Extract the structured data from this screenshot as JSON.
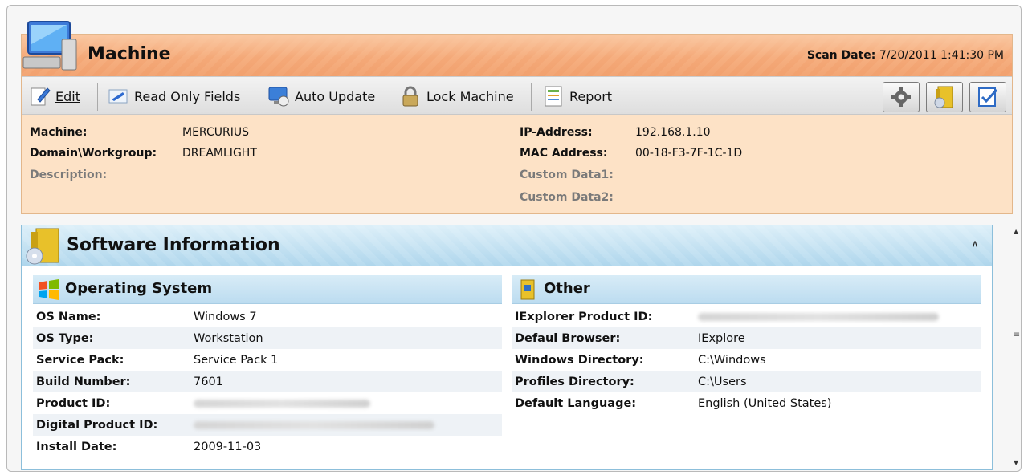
{
  "machine_panel": {
    "title": "Machine",
    "scan_date_label": "Scan Date:",
    "scan_date_value": "7/20/2011 1:41:30 PM",
    "toolbar": {
      "edit": "Edit",
      "read_only_fields": "Read Only Fields",
      "auto_update": "Auto Update",
      "lock_machine": "Lock Machine",
      "report": "Report"
    },
    "fields": {
      "machine_label": "Machine:",
      "machine_value": "MERCURIUS",
      "domain_label": "Domain\\Workgroup:",
      "domain_value": "DREAMLIGHT",
      "description_label": "Description:",
      "ip_label": "IP-Address:",
      "ip_value": "192.168.1.10",
      "mac_label": "MAC Address:",
      "mac_value": "00-18-F3-7F-1C-1D",
      "custom1_label": "Custom Data1:",
      "custom2_label": "Custom Data2:"
    }
  },
  "software_panel": {
    "title": "Software Information",
    "os": {
      "title": "Operating System",
      "rows": [
        {
          "k": "OS Name:",
          "v": "Windows 7"
        },
        {
          "k": "OS Type:",
          "v": "Workstation"
        },
        {
          "k": "Service Pack:",
          "v": "Service Pack 1"
        },
        {
          "k": "Build Number:",
          "v": "7601"
        },
        {
          "k": "Product ID:",
          "v": ""
        },
        {
          "k": "Digital Product ID:",
          "v": ""
        },
        {
          "k": "Install Date:",
          "v": "2009-11-03"
        }
      ]
    },
    "other": {
      "title": "Other",
      "rows": [
        {
          "k": "IExplorer Product ID:",
          "v": ""
        },
        {
          "k": "Defaul Browser:",
          "v": "IExplore"
        },
        {
          "k": "Windows Directory:",
          "v": "C:\\Windows"
        },
        {
          "k": "Profiles Directory:",
          "v": "C:\\Users"
        },
        {
          "k": "Default Language:",
          "v": "English (United States)"
        }
      ]
    }
  },
  "icons": [
    "computer-icon",
    "edit-icon",
    "read-only-icon",
    "auto-update-icon",
    "lock-icon",
    "report-icon",
    "settings-icon",
    "software-icon",
    "check-icon",
    "windows-logo-icon",
    "folder-icon",
    "collapse-icon"
  ],
  "colors": {
    "machine_bg": "#fde2c6",
    "machine_header": "#f4ab7c",
    "software_header": "#b9dcef"
  }
}
